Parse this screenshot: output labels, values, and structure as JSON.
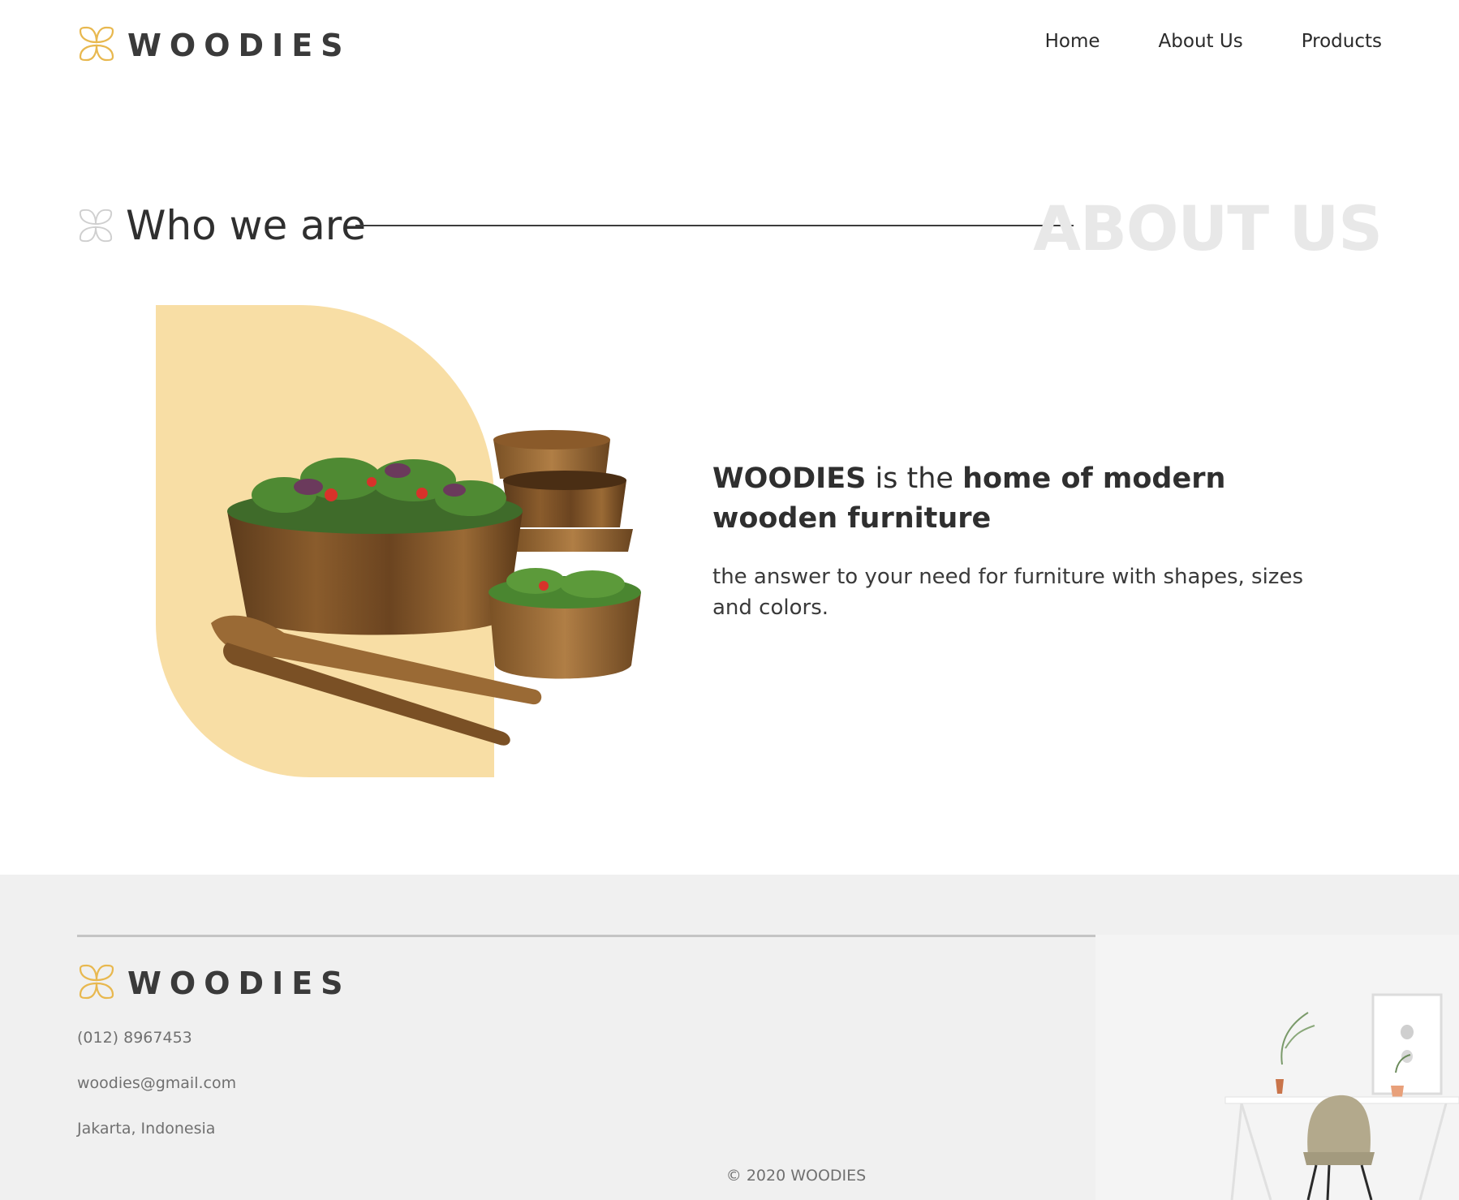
{
  "brand": {
    "name": "WOODIES",
    "accent": "#e8b84f"
  },
  "nav": {
    "items": [
      "Home",
      "About Us",
      "Products"
    ]
  },
  "section": {
    "title": "Who we are",
    "ghost_title": "ABOUT US"
  },
  "intro": {
    "brand": "WOODIES",
    "connector": " is the ",
    "highlight": "home of modern wooden furniture",
    "description": "the answer to your need for furniture with shapes, sizes and colors."
  },
  "footer": {
    "brand_name": "WOODIES",
    "phone": "(012) 8967453",
    "email": "woodies@gmail.com",
    "location": "Jakarta, Indonesia",
    "copyright": "© 2020 WOODIES"
  },
  "images": {
    "hero": "salad-bowls-image",
    "footer": "desk-chair-room-image"
  },
  "colors": {
    "hero_shape": "#f8dea5",
    "footer_bg": "#f0f0f0",
    "ghost_text": "#e8e8e8"
  }
}
